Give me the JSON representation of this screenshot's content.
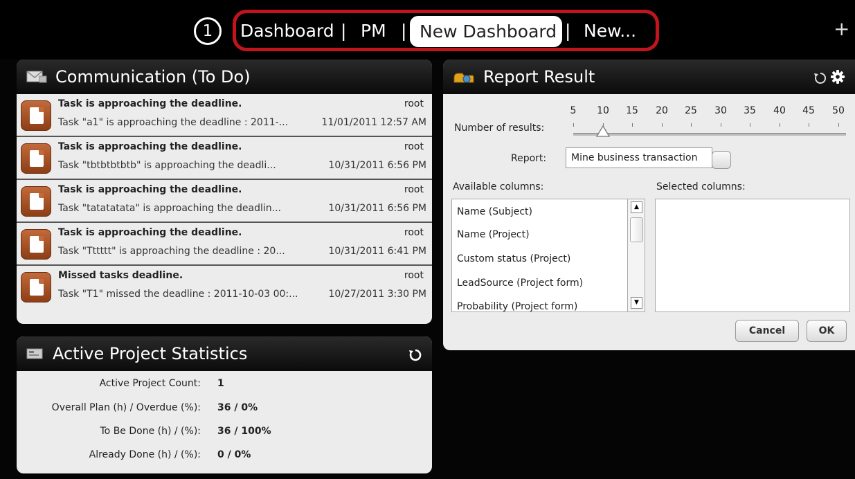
{
  "step_number": "1",
  "tabs": [
    {
      "label": "Dashboard"
    },
    {
      "label": "PM"
    },
    {
      "label": "New Dashboard"
    },
    {
      "label": "New..."
    }
  ],
  "tab_separator": "|",
  "add_tab_glyph": "+",
  "communication": {
    "title": "Communication (To Do)",
    "icon": "envelope-icon",
    "messages": [
      {
        "title": "Task is approaching the deadline.",
        "sender": "root",
        "body": "Task \"a1\" is approaching the deadline : 2011-...",
        "time": "11/01/2011 12:57 AM"
      },
      {
        "title": "Task is approaching the deadline.",
        "sender": "root",
        "body": "Task \"tbtbtbtbtb\" is approaching the deadli...",
        "time": "10/31/2011 6:56 PM"
      },
      {
        "title": "Task is approaching the deadline.",
        "sender": "root",
        "body": "Task \"tatatatata\" is approaching the deadlin...",
        "time": "10/31/2011 6:56 PM"
      },
      {
        "title": "Task is approaching the deadline.",
        "sender": "root",
        "body": "Task \"Tttttt\" is approaching the deadline : 20...",
        "time": "10/31/2011 6:41 PM"
      },
      {
        "title": "Missed tasks deadline.",
        "sender": "root",
        "body": "Task \"T1\" missed the deadline : 2011-10-03 00:...",
        "time": "10/27/2011 3:30 PM"
      }
    ]
  },
  "stats": {
    "title": "Active Project Statistics",
    "rows": [
      {
        "label": "Active Project Count:",
        "value": "1"
      },
      {
        "label": "Overall Plan (h) / Overdue (%):",
        "value": "36 / 0%"
      },
      {
        "label": "To Be Done (h) / (%):",
        "value": "36 / 100%"
      },
      {
        "label": "Already Done (h) / (%):",
        "value": "0 / 0%"
      }
    ]
  },
  "report": {
    "title": "Report Result",
    "num_results_label": "Number of results:",
    "slider_ticks": [
      "5",
      "10",
      "15",
      "20",
      "25",
      "30",
      "35",
      "40",
      "45",
      "50"
    ],
    "slider_value": 10,
    "report_label": "Report:",
    "report_value": "Mine business transaction",
    "available_label": "Available columns:",
    "selected_label": "Selected columns:",
    "available_columns": [
      "Name (Subject)",
      "Name (Project)",
      "Custom status (Project)",
      "LeadSource (Project form)",
      "Probability (Project form)"
    ],
    "selected_columns": [],
    "cancel_label": "Cancel",
    "ok_label": "OK"
  },
  "colors": {
    "highlight": "#c4141b",
    "background": "#050505",
    "panel": "#ececec",
    "message_icon": "#b05a2a"
  }
}
